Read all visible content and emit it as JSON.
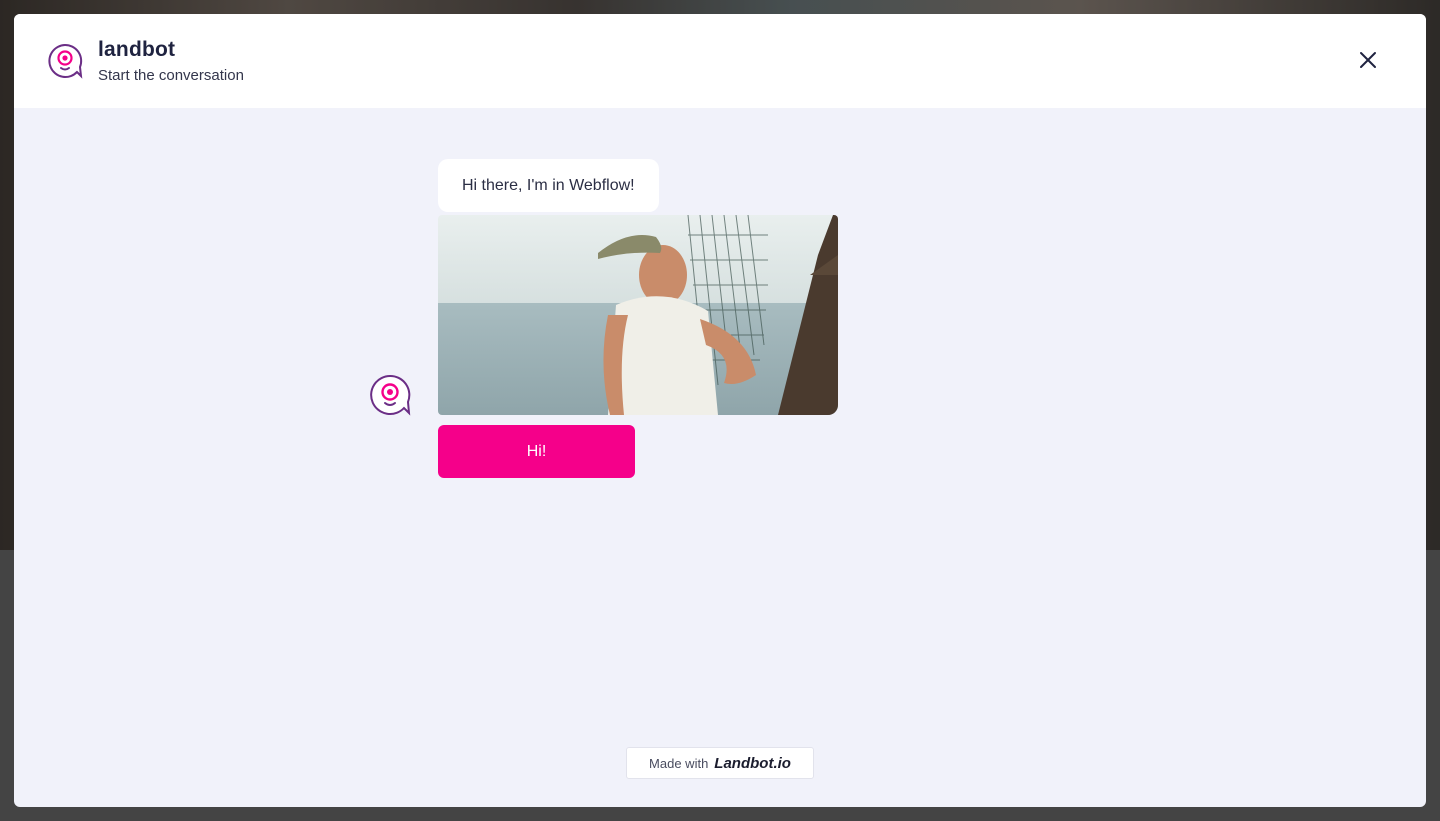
{
  "header": {
    "brand_name": "landbot",
    "subtitle": "Start the conversation",
    "logo_icon": "landbot-logo-icon",
    "close_icon": "close-icon"
  },
  "chat": {
    "bot_avatar_icon": "landbot-avatar-icon",
    "message_text": "Hi there, I'm in Webflow!",
    "reply_button_label": "Hi!"
  },
  "footer": {
    "made_with_label": "Made with",
    "made_with_brand": "Landbot.io"
  },
  "colors": {
    "accent": "#f5008a",
    "logo_purple": "#6b2e86",
    "header_text": "#1f2340",
    "chat_bg": "#f1f2fa"
  }
}
